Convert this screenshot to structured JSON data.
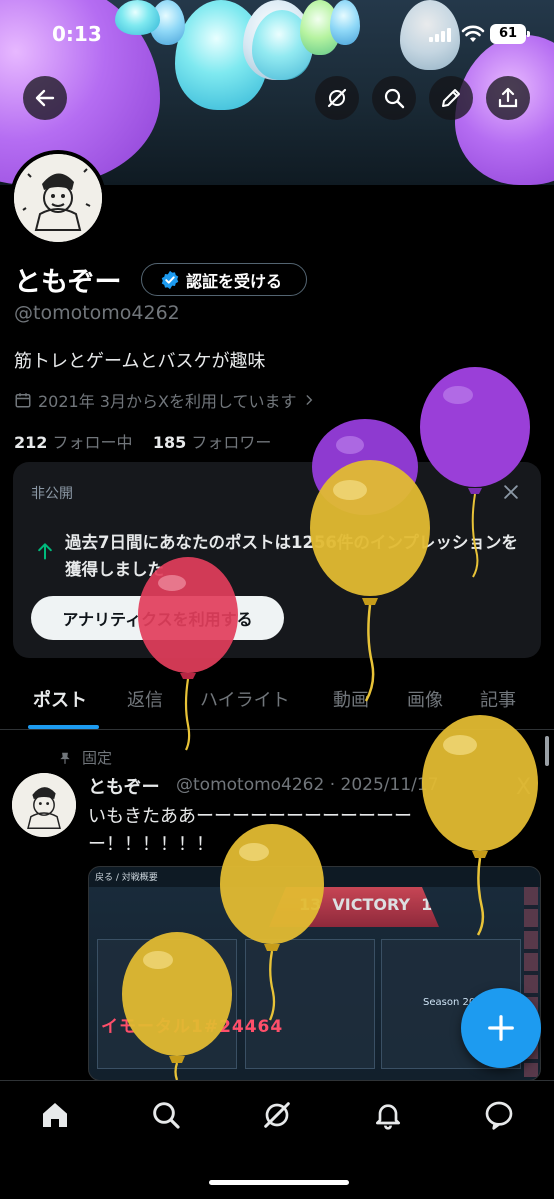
{
  "status_bar": {
    "time": "0:13",
    "battery": "61"
  },
  "profile": {
    "display_name": "ともぞー",
    "verify_button": "認証を受ける",
    "handle": "@tomotomo4262",
    "bio": "筋トレとゲームとバスケが趣味",
    "joined": "2021年 3月からXを利用しています",
    "following_count": "212",
    "following_label": "フォロー中",
    "followers_count": "185",
    "followers_label": "フォロワー"
  },
  "private_card": {
    "label": "非公開",
    "message": "過去7日間にあなたのポストは1256件のインプレッションを獲得しました",
    "cta": "アナリティクスを利用する"
  },
  "tabs": [
    "ポスト",
    "返信",
    "ハイライト",
    "動画",
    "画像",
    "記事"
  ],
  "pinned_post": {
    "pinned_label": "固定",
    "name": "ともぞー",
    "meta": "@tomotomo4262 · 2025/11/17",
    "text": "いもきたああーーーーーーーーーーーーー！！！！！！",
    "media": {
      "top_left": "戻る / 対戦概要",
      "score_left": "13",
      "result": "VICTORY",
      "score_right": "10",
      "rank_text": "イモータル1#24464",
      "season": "Season 2025 // A"
    }
  },
  "icons": {
    "back": "arrow-left-icon",
    "grok": "grok-icon",
    "search": "search-icon",
    "edit": "pencil-icon",
    "share": "share-icon",
    "calendar": "calendar-icon",
    "fab": "plus-icon"
  },
  "colors": {
    "accent": "#1d9bf0",
    "balloon_yellow": "#e8c338",
    "balloon_purple": "#9b3fd6",
    "balloon_red": "#e8415c"
  }
}
